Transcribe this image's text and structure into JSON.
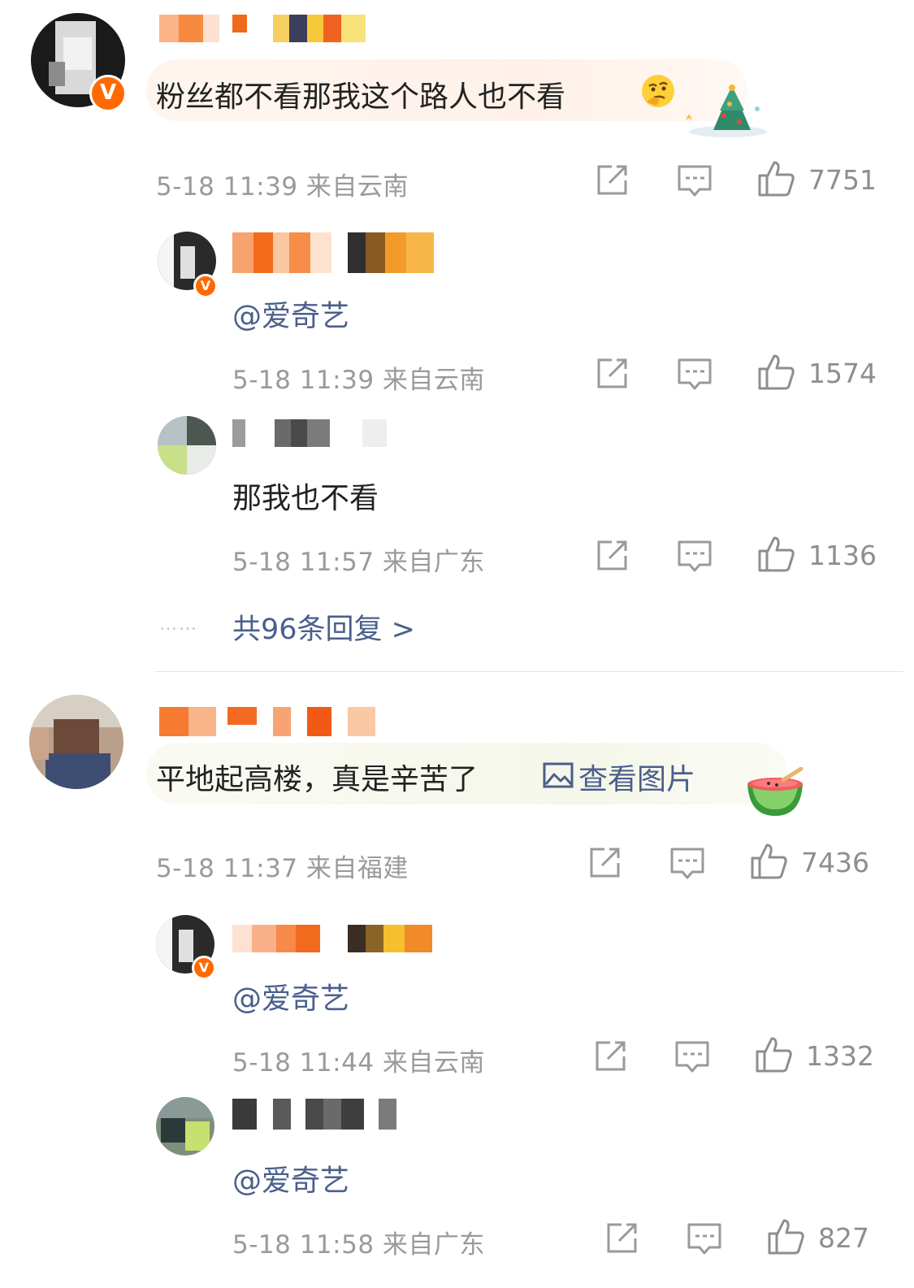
{
  "colors": {
    "link": "#4a5f8c",
    "meta_gray": "#9a9a9a",
    "verified_orange": "#ff6a00",
    "bubble_pink": "#fff3ec",
    "bubble_green": "#f7f8ee"
  },
  "icons": {
    "share": "share-icon",
    "comment": "comment-icon",
    "like": "thumbs-up-icon"
  },
  "threads": [
    {
      "comment": {
        "text": "粉丝都不看那我这个路人也不看",
        "emoji": "thinking-face-emoji",
        "time": "5-18 11:39",
        "location": "来自云南",
        "likes": "7751",
        "bubble_decoration": "christmas-tree-sticker"
      },
      "replies": [
        {
          "text": "@爱奇艺",
          "time": "5-18 11:39",
          "location": "来自云南",
          "likes": "1574"
        },
        {
          "text": "那我也不看",
          "time": "5-18 11:57",
          "location": "来自广东",
          "likes": "1136"
        }
      ],
      "more_replies": "共96条回复 >",
      "dots": "……"
    },
    {
      "comment": {
        "text": "平地起高楼，真是辛苦了",
        "link": "查看图片",
        "time": "5-18 11:37",
        "location": "来自福建",
        "likes": "7436",
        "bubble_decoration": "watermelon-sticker"
      },
      "replies": [
        {
          "text": "@爱奇艺",
          "time": "5-18 11:44",
          "location": "来自云南",
          "likes": "1332"
        },
        {
          "text": "@爱奇艺",
          "time": "5-18 11:58",
          "location": "来自广东",
          "likes": "827"
        }
      ]
    }
  ]
}
